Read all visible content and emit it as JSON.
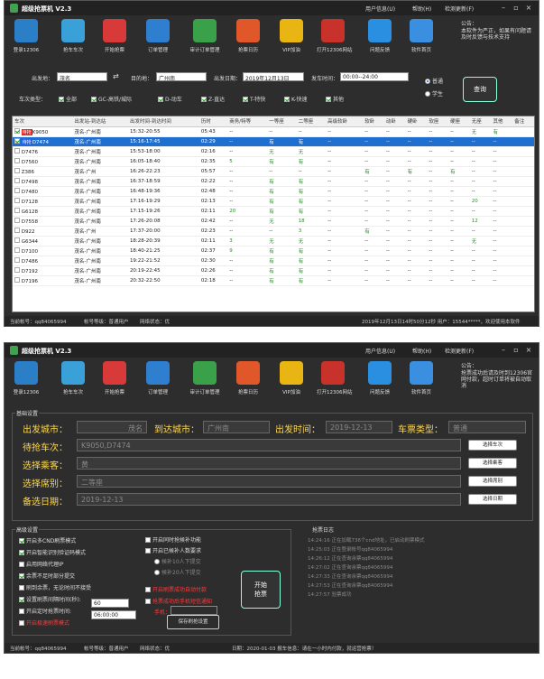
{
  "app": {
    "title": "超级抢票机 V2.3",
    "menu": [
      "用户信息(U)",
      "帮助(H)",
      "检测更新(F)"
    ]
  },
  "toolbar": [
    {
      "label": "登录12306",
      "icon": "user-key-icon",
      "color": "#2a7fc6"
    },
    {
      "label": "抢车车次",
      "icon": "train-icon",
      "color": "#3aa0d8"
    },
    {
      "label": "开始抢票",
      "icon": "ticket-icon",
      "color": "#d83a3a"
    },
    {
      "label": "订单管理",
      "icon": "clipboard-icon",
      "color": "#2f7fd0"
    },
    {
      "label": "审计订单管理",
      "icon": "order-check-icon",
      "color": "#3aa04a"
    },
    {
      "label": "抢票日历",
      "icon": "calendar-clock-icon",
      "color": "#e0582a"
    },
    {
      "label": "VIP加油",
      "icon": "vip-crown-icon",
      "color": "#e8b512"
    },
    {
      "label": "打开12306网站",
      "icon": "railway-logo-icon",
      "color": "#c8322b"
    },
    {
      "label": "问题反馈",
      "icon": "help-icon",
      "color": "#2a8fe0"
    },
    {
      "label": "软件首页",
      "icon": "home-icon",
      "color": "#3a8fe0"
    }
  ],
  "notice": {
    "title": "公告：",
    "text1": "本软件为严正，如果有问题请及时反馈与技术支持",
    "text2": "抢票成功后请及时到12306官网付款，超时订单将被自动取消"
  },
  "search": {
    "from_label": "出发地：",
    "from_value": "茂名",
    "to_label": "目的地：",
    "to_value": "广州南",
    "date_label": "出发日期：",
    "date_value": "2019年12月13日",
    "time_label": "发车时间：",
    "time_value": "00:00--24:00",
    "swap_icon": "swap-arrows-icon",
    "radio_normal": "普通",
    "radio_student": "学生",
    "query_button": "查询",
    "type_label": "车次类型：",
    "types": [
      "全部",
      "GC-高铁/城际",
      "D-动车",
      "Z-直达",
      "T-特快",
      "K-快速",
      "其他"
    ]
  },
  "table": {
    "headers": [
      "车次",
      "出发站-到达站",
      "出发时间-到达时间",
      "历时",
      "商务/特等",
      "一等座",
      "二等座",
      "高级软卧",
      "软卧",
      "动卧",
      "硬卧",
      "软座",
      "硬座",
      "无座",
      "其他",
      "备注"
    ],
    "rows": [
      {
        "train": "K9050",
        "tag": "待抢",
        "tag_color": "#e02020",
        "stations": "茂名-广州南",
        "times": "15:32-20:55",
        "dur": "05:43",
        "cells": [
          "--",
          "--",
          "--",
          "--",
          "--",
          "--",
          "--",
          "--",
          "--",
          "无",
          "有",
          ""
        ],
        "selected": false,
        "checked": true
      },
      {
        "train": "D7474",
        "tag": "待抢",
        "tag_color": "#2060e0",
        "stations": "茂名-广州南",
        "times": "15:16-17:45",
        "dur": "02:29",
        "cells": [
          "--",
          "有",
          "有",
          "--",
          "--",
          "--",
          "--",
          "--",
          "--",
          "--",
          "--",
          ""
        ],
        "selected": true,
        "checked": true
      },
      {
        "train": "D7476",
        "stations": "茂名-广州南",
        "times": "15:53-18:00",
        "dur": "02:16",
        "cells": [
          "--",
          "无",
          "无",
          "--",
          "--",
          "--",
          "--",
          "--",
          "--",
          "--",
          "--",
          ""
        ]
      },
      {
        "train": "D7560",
        "stations": "茂名-广州南",
        "times": "16:05-18:40",
        "dur": "02:35",
        "cells": [
          "5",
          "有",
          "有",
          "--",
          "--",
          "--",
          "--",
          "--",
          "--",
          "--",
          "--",
          ""
        ]
      },
      {
        "train": "Z386",
        "stations": "茂名-广州",
        "times": "16:26-22:23",
        "dur": "05:57",
        "cells": [
          "--",
          "--",
          "--",
          "--",
          "有",
          "--",
          "有",
          "--",
          "有",
          "--",
          "--",
          ""
        ]
      },
      {
        "train": "D7498",
        "stations": "茂名-广州南",
        "times": "16:37-18:59",
        "dur": "02:22",
        "cells": [
          "--",
          "有",
          "有",
          "--",
          "--",
          "--",
          "--",
          "--",
          "--",
          "--",
          "--",
          ""
        ]
      },
      {
        "train": "D7480",
        "stations": "茂名-广州南",
        "times": "16:48-19:36",
        "dur": "02:48",
        "cells": [
          "--",
          "有",
          "有",
          "--",
          "--",
          "--",
          "--",
          "--",
          "--",
          "--",
          "--",
          ""
        ]
      },
      {
        "train": "D7128",
        "stations": "茂名-广州南",
        "times": "17:16-19:29",
        "dur": "02:13",
        "cells": [
          "--",
          "有",
          "有",
          "--",
          "--",
          "--",
          "--",
          "--",
          "--",
          "20",
          "--",
          ""
        ]
      },
      {
        "train": "G6128",
        "stations": "茂名-广州南",
        "times": "17:15-19:26",
        "dur": "02:11",
        "cells": [
          "20",
          "有",
          "有",
          "--",
          "--",
          "--",
          "--",
          "--",
          "--",
          "--",
          "--",
          ""
        ]
      },
      {
        "train": "D7558",
        "stations": "茂名-广州南",
        "times": "17:26-20:08",
        "dur": "02:42",
        "cells": [
          "--",
          "无",
          "18",
          "--",
          "--",
          "--",
          "--",
          "--",
          "--",
          "12",
          "--",
          ""
        ]
      },
      {
        "train": "D922",
        "stations": "茂名-广州",
        "times": "17:37-20:00",
        "dur": "02:23",
        "cells": [
          "--",
          "--",
          "3",
          "--",
          "有",
          "--",
          "--",
          "--",
          "--",
          "--",
          "--",
          ""
        ]
      },
      {
        "train": "G6344",
        "stations": "茂名-广州南",
        "times": "18:28-20:39",
        "dur": "02:11",
        "cells": [
          "3",
          "无",
          "无",
          "--",
          "--",
          "--",
          "--",
          "--",
          "--",
          "无",
          "--",
          ""
        ]
      },
      {
        "train": "D7100",
        "stations": "茂名-广州南",
        "times": "18:40-21:25",
        "dur": "02:37",
        "cells": [
          "9",
          "有",
          "有",
          "--",
          "--",
          "--",
          "--",
          "--",
          "--",
          "--",
          "--",
          ""
        ]
      },
      {
        "train": "D7486",
        "stations": "茂名-广州南",
        "times": "19:22-21:52",
        "dur": "02:30",
        "cells": [
          "--",
          "有",
          "有",
          "--",
          "--",
          "--",
          "--",
          "--",
          "--",
          "--",
          "--",
          ""
        ]
      },
      {
        "train": "D7192",
        "stations": "茂名-广州南",
        "times": "20:19-22:45",
        "dur": "02:26",
        "cells": [
          "--",
          "有",
          "有",
          "--",
          "--",
          "--",
          "--",
          "--",
          "--",
          "--",
          "--",
          ""
        ]
      },
      {
        "train": "D7196",
        "stations": "茂名-广州南",
        "times": "20:32-22:50",
        "dur": "02:18",
        "cells": [
          "--",
          "有",
          "有",
          "--",
          "--",
          "--",
          "--",
          "--",
          "--",
          "--",
          "--",
          ""
        ]
      }
    ]
  },
  "status1": {
    "account": "当前帐号：qq84065994",
    "level": "帐号等级：普通用户",
    "net": "网络状态：优",
    "right": "2019年12月13日14时50分12秒  用户：15544*****，欢迎使用本软件"
  },
  "grab": {
    "section_label": "基础设置",
    "from_label": "出发城市：",
    "from_value": "茂名",
    "to_label": "到达城市：",
    "to_value": "广州南",
    "date_label": "出发时间：",
    "date_value": "2019-12-13",
    "type_label": "车票类型：",
    "type_value": "普通",
    "trains_label": "待抢车次：",
    "trains_value": "K9050,D7474",
    "trains_btn": "选择车次",
    "pass_label": "选择乘客：",
    "pass_value": "黄",
    "pass_btn": "选择乘客",
    "seat_label": "选择席别：",
    "seat_value": "二等座",
    "seat_btn": "选择席别",
    "alt_label": "备选日期：",
    "alt_value": "2019-12-13",
    "alt_btn": "选择日期",
    "adv_label": "高级设置",
    "adv_left": [
      {
        "text": "开启多CND刷票模式",
        "on": true,
        "red": false
      },
      {
        "text": "开启智能识别验证码模式",
        "on": true,
        "red": false
      },
      {
        "text": "启用网络代理IP",
        "on": false,
        "red": false
      },
      {
        "text": "余票不足时部分提交",
        "on": true,
        "red": false
      },
      {
        "text": "刷到余票，无论时间不接受",
        "on": false,
        "red": false
      },
      {
        "text": "设置刷票间隔时间(秒):",
        "on": true,
        "red": false
      },
      {
        "text": "开启定时抢票时间:",
        "on": false,
        "red": false
      },
      {
        "text": "开启极速刷票模式",
        "on": false,
        "red": true
      }
    ],
    "interval_value": "60",
    "timer_value": "06:00:00",
    "adv_mid": [
      {
        "text": "开启同时抢候补功能",
        "on": false,
        "red": false
      },
      {
        "text": "开启已候补人数要求",
        "on": false,
        "red": false
      },
      {
        "text": "开启刷票成功自动付款",
        "on": false,
        "red": true
      },
      {
        "text": "抢票成功后手机短信通知",
        "on": false,
        "red": true
      }
    ],
    "radio1": "候补10人下提交",
    "radio2": "候补20人下提交",
    "phone_label": "手机：",
    "save_btn": "保存刷抢设置",
    "start_btn_line1": "开始",
    "start_btn_line2": "抢票",
    "log_label": "抢票日志",
    "log": [
      "14:24:16  正在加载736个cnd地址，已启动刷票模式",
      "14:25:03  正在登录帐号qq84065994",
      "14:26:12  正在查询余票qq84065994",
      "14:27:02  正在查询余票qq84065994",
      "14:27:33  正在查询余票qq84065994",
      "14:27:53  正在查询余票qq84065994",
      "14:27:57  验票成功"
    ]
  },
  "status2": {
    "account": "当前帐号：qq84065994",
    "level": "帐号等级：普通用户",
    "net": "网络状态：优",
    "right": "日期：2020-01-03  报车信息：请在一小时内付款，就运营抢票！"
  }
}
